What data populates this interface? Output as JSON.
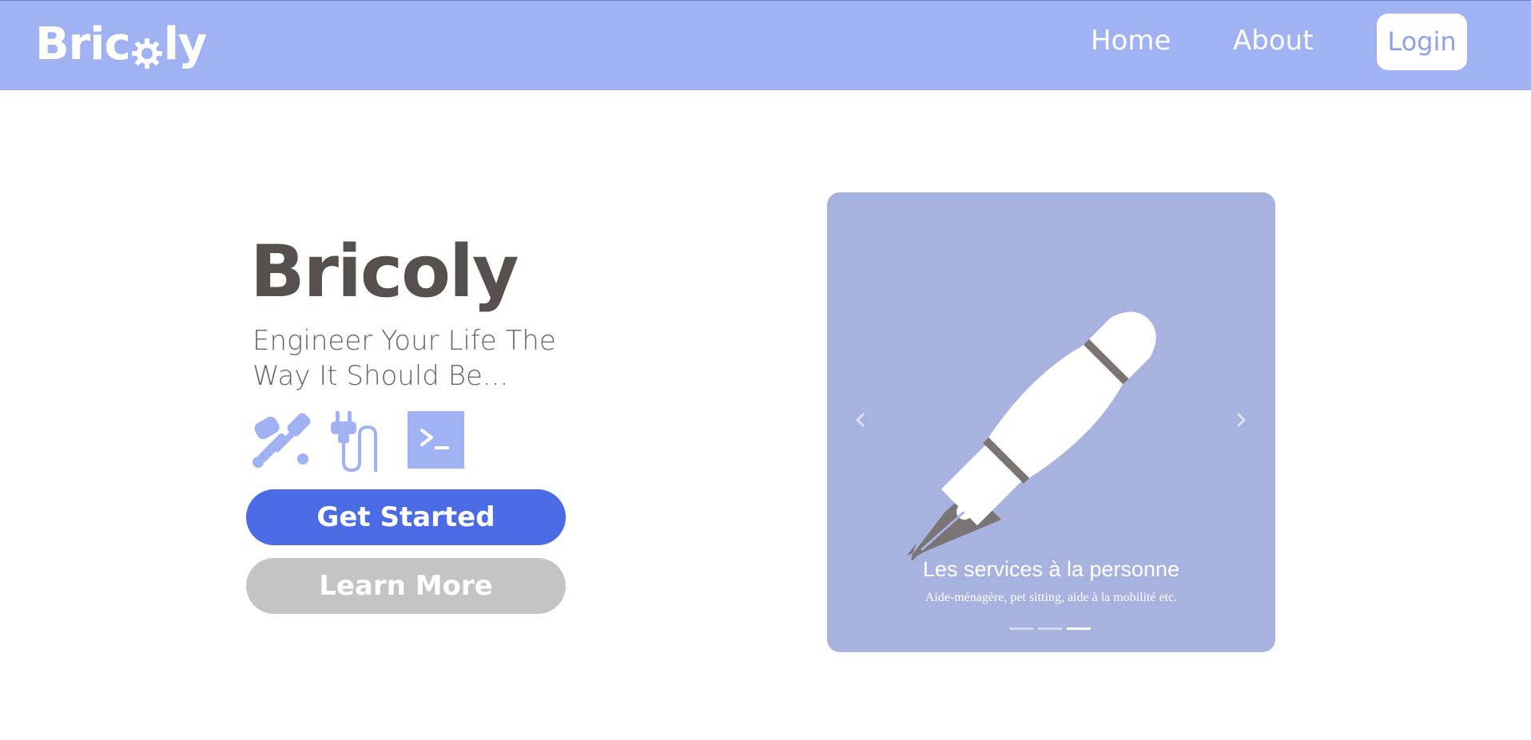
{
  "navbar": {
    "logo_prefix": "Bric",
    "logo_suffix": "ly",
    "links": [
      {
        "label": "Home"
      },
      {
        "label": "About"
      }
    ],
    "login_label": "Login"
  },
  "hero": {
    "title": "Bricoly",
    "subtitle": "Engineer Your Life The Way It Should Be...",
    "icons": [
      "tools-icon",
      "plug-icon",
      "terminal-icon"
    ],
    "get_started_label": "Get Started",
    "learn_more_label": "Learn More"
  },
  "carousel": {
    "slide_icon": "fountain-pen-icon",
    "caption_title": "Les services à la personne",
    "caption_text": "Aide-ménagère, pet sitting, aide à la mobilité etc.",
    "slide_count": 3,
    "active_index": 2
  },
  "colors": {
    "navbar_bg": "#a1b2f2",
    "primary_button": "#4a6be3",
    "secondary_button": "#c4c4c4",
    "carousel_bg": "#a7b3de",
    "title_text": "#565050"
  }
}
